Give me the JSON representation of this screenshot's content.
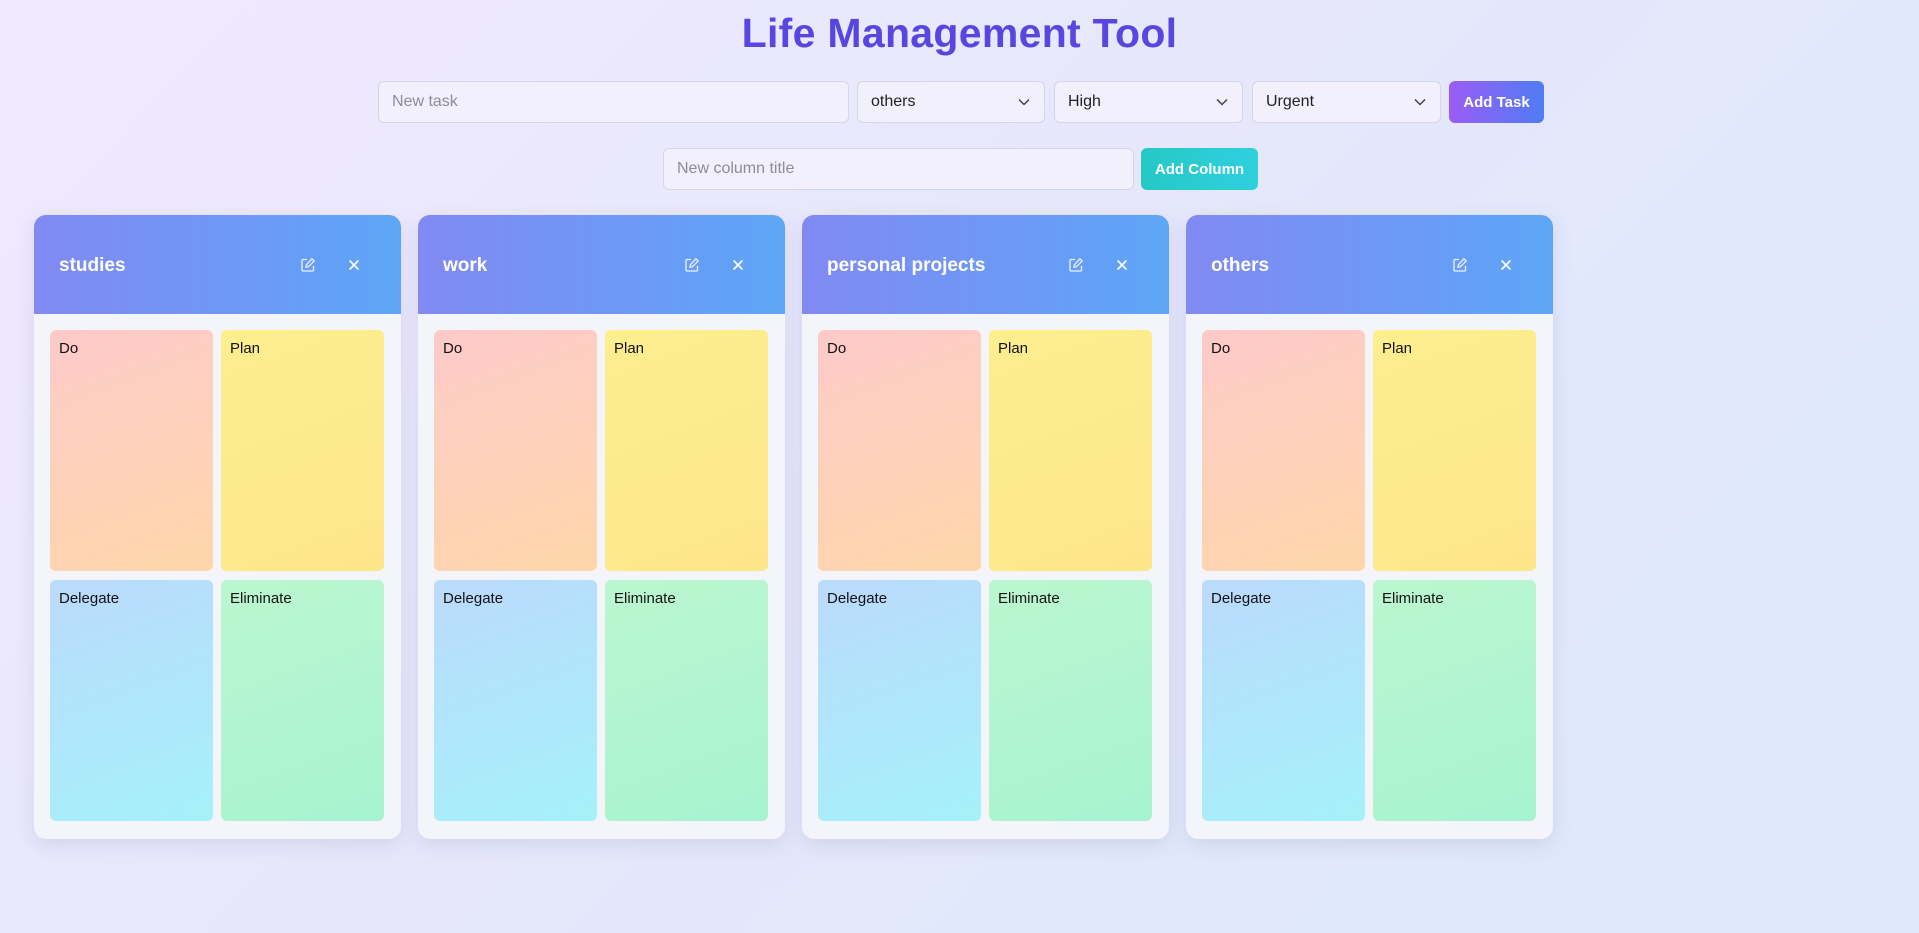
{
  "app": {
    "title": "Life Management Tool"
  },
  "task_form": {
    "task_placeholder": "New task",
    "category_value": "others",
    "priority_value": "High",
    "urgency_value": "Urgent",
    "add_label": "Add Task"
  },
  "column_form": {
    "title_placeholder": "New column title",
    "add_label": "Add Column"
  },
  "columns": [
    {
      "title": "studies",
      "quadrants": [
        "Do",
        "Plan",
        "Delegate",
        "Eliminate"
      ]
    },
    {
      "title": "work",
      "quadrants": [
        "Do",
        "Plan",
        "Delegate",
        "Eliminate"
      ]
    },
    {
      "title": "personal projects",
      "quadrants": [
        "Do",
        "Plan",
        "Delegate",
        "Eliminate"
      ]
    },
    {
      "title": "others",
      "quadrants": [
        "Do",
        "Plan",
        "Delegate",
        "Eliminate"
      ]
    }
  ],
  "icons": {
    "edit": "edit-icon",
    "close": "close-icon",
    "dropdown": "chevron-down-icon"
  },
  "colors": {
    "title": "#5846e0",
    "header_start": "#8189f3",
    "header_end": "#5da6f6",
    "add_task_start": "#9b5cf5",
    "add_task_end": "#4f7df3",
    "add_column": "#26c8c5"
  }
}
